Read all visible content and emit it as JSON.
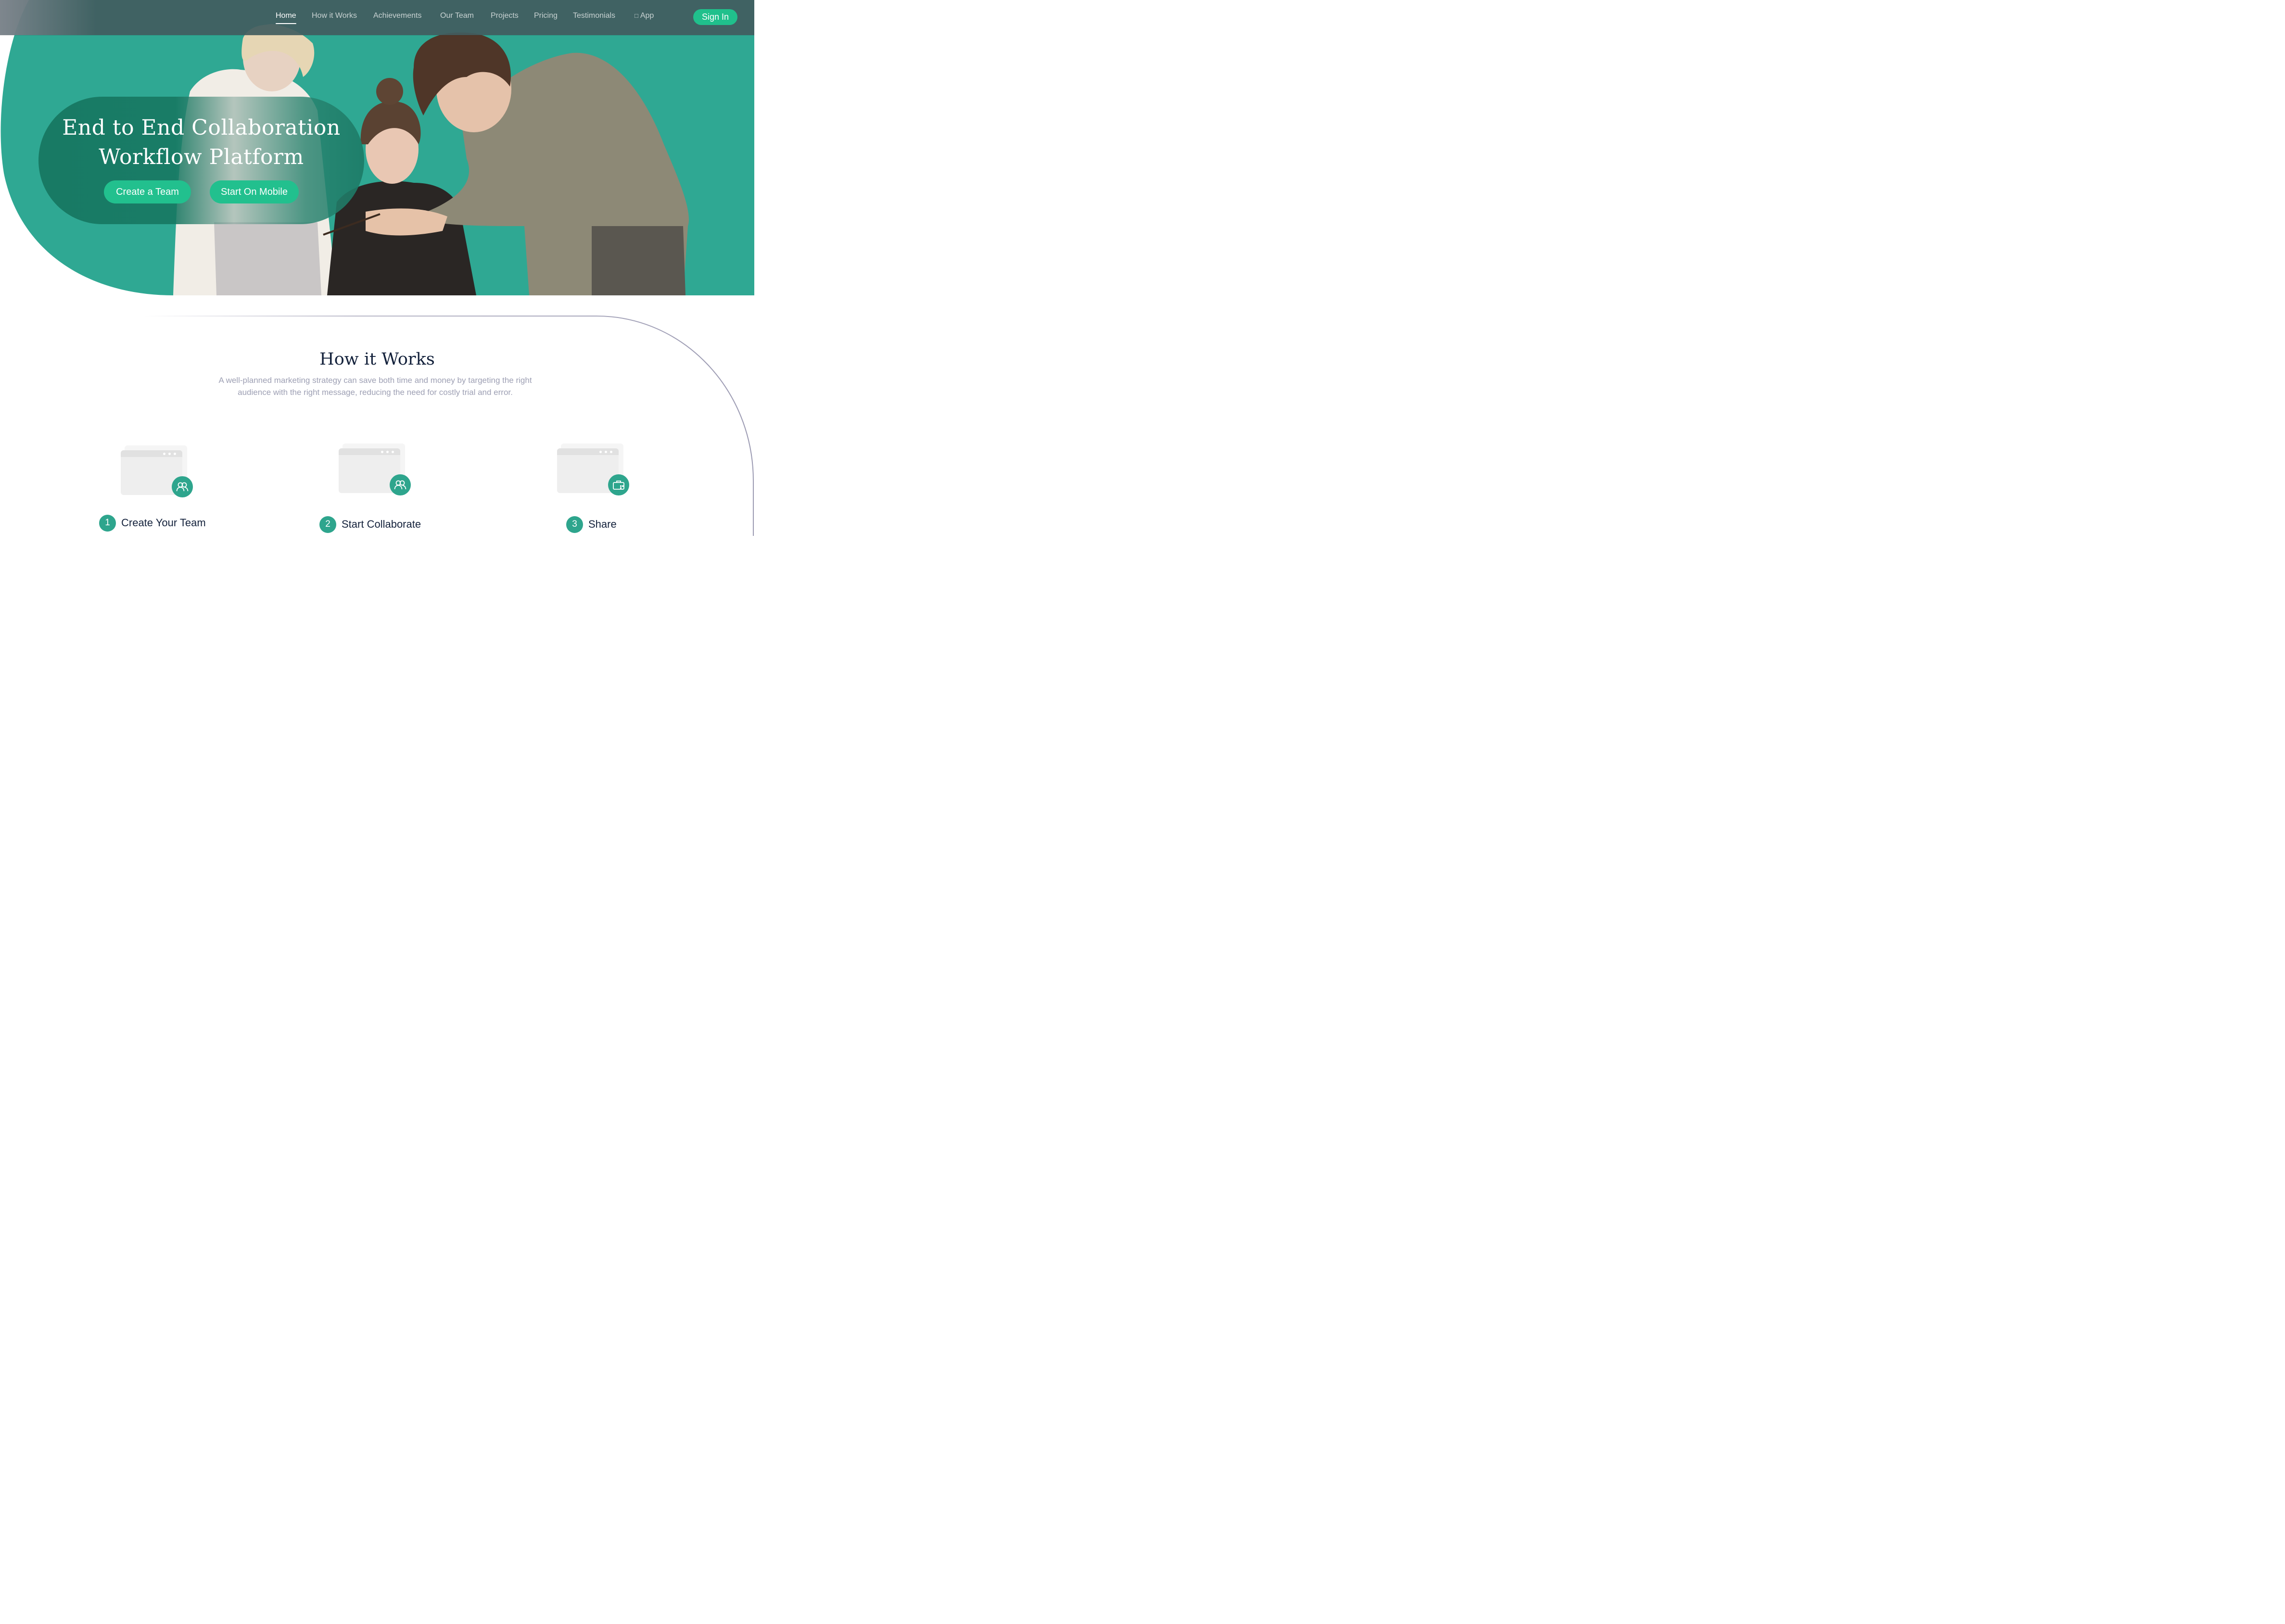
{
  "nav": {
    "items": [
      {
        "label": "Home",
        "active": true
      },
      {
        "label": "How it Works",
        "active": false
      },
      {
        "label": "Achievements",
        "active": false
      },
      {
        "label": "Our Team",
        "active": false
      },
      {
        "label": "Projects",
        "active": false
      },
      {
        "label": "Pricing",
        "active": false
      },
      {
        "label": "Testimonials",
        "active": false
      },
      {
        "label": "App",
        "active": false
      }
    ],
    "app_icon": "apple-icon",
    "signin_label": "Sign In"
  },
  "hero": {
    "title_line1": "End to End Collaboration",
    "title_line2": "Workflow Platform",
    "primary_button": "Create a Team",
    "secondary_button": "Start On Mobile"
  },
  "how_it_works": {
    "title": "How it Works",
    "description_line1": "A well-planned marketing strategy can save both time and money by targeting the right",
    "description_line2": "audience with the right message, reducing the need for costly trial and error.",
    "steps": [
      {
        "number": "1",
        "label": "Create Your Team",
        "icon": "users-icon"
      },
      {
        "number": "2",
        "label": "Start Collaborate",
        "icon": "users-icon"
      },
      {
        "number": "3",
        "label": "Share",
        "icon": "briefcase-icon"
      }
    ]
  },
  "colors": {
    "brand_teal": "#2fa893",
    "accent_green": "#20c08c",
    "nav_bg": "#425c5e",
    "heading": "#13213b",
    "muted": "#9ea0b4"
  }
}
